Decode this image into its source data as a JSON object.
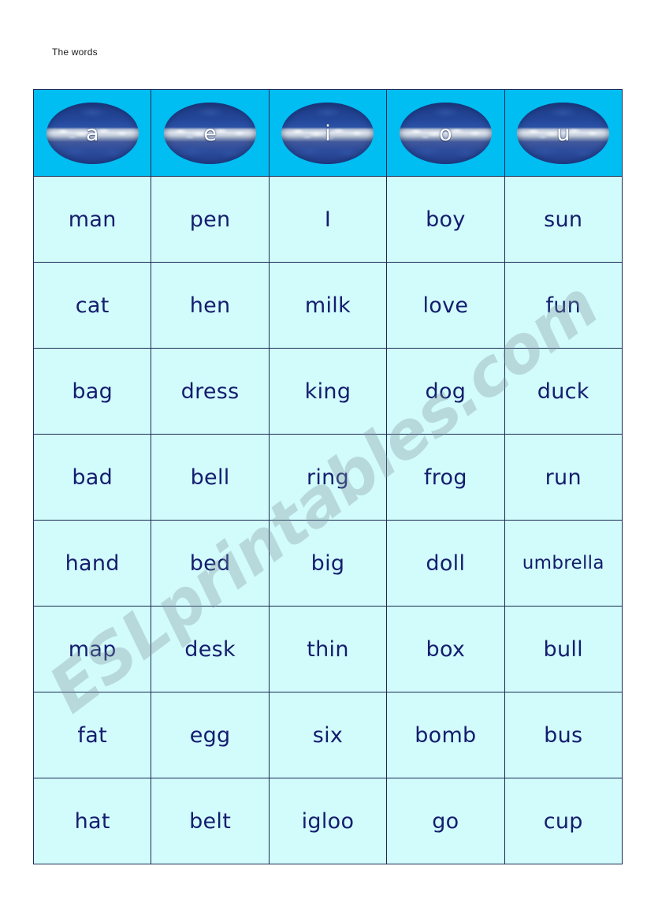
{
  "document": {
    "title": "The words",
    "watermark": "ESLprintables.com"
  },
  "colors": {
    "header_background": "#00bdf2",
    "cell_background": "#d2fbfb",
    "word_text": "#141d6e",
    "border": "#1b2a55",
    "oval_letter": "#ffffff",
    "watermark": "#8296 9b"
  },
  "table": {
    "columns": [
      {
        "vowel": "a",
        "icon": "cloud-oval-icon"
      },
      {
        "vowel": "e",
        "icon": "cloud-oval-icon"
      },
      {
        "vowel": "i",
        "icon": "cloud-oval-icon"
      },
      {
        "vowel": "o",
        "icon": "cloud-oval-icon"
      },
      {
        "vowel": "u",
        "icon": "cloud-oval-icon"
      }
    ],
    "rows": [
      [
        "man",
        "pen",
        "I",
        "boy",
        "sun"
      ],
      [
        "cat",
        "hen",
        "milk",
        "love",
        "fun"
      ],
      [
        "bag",
        "dress",
        "king",
        "dog",
        "duck"
      ],
      [
        "bad",
        "bell",
        "ring",
        "frog",
        "run"
      ],
      [
        "hand",
        "bed",
        "big",
        "doll",
        "umbrella"
      ],
      [
        "map",
        "desk",
        "thin",
        "box",
        "bull"
      ],
      [
        "fat",
        "egg",
        "six",
        "bomb",
        "bus"
      ],
      [
        "hat",
        "belt",
        "igloo",
        "go",
        "cup"
      ]
    ]
  }
}
